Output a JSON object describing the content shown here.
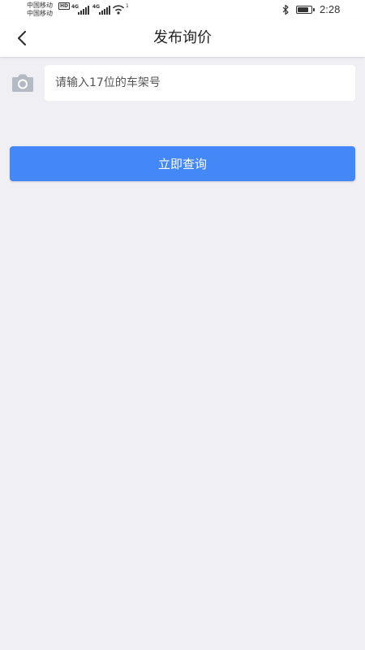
{
  "status_bar": {
    "carrier_1": "中国移动",
    "carrier_1_badge": "HD",
    "carrier_2": "中国移动",
    "network_1": "4G",
    "network_2": "4G",
    "wifi_label": "1",
    "time": "2:28",
    "battery_level": 0.85,
    "text_color": "#333333"
  },
  "header": {
    "title": "发布询价",
    "back_icon": "chevron-left-icon"
  },
  "vin_form": {
    "camera_icon": "camera-icon",
    "camera_icon_color": "#b4bac4",
    "input_value": "",
    "input_placeholder": "请输入17位的车架号"
  },
  "actions": {
    "query_label": "立即查询",
    "query_color": "#4388f6"
  },
  "colors": {
    "page_background": "#efeff4",
    "surface": "#ffffff"
  }
}
